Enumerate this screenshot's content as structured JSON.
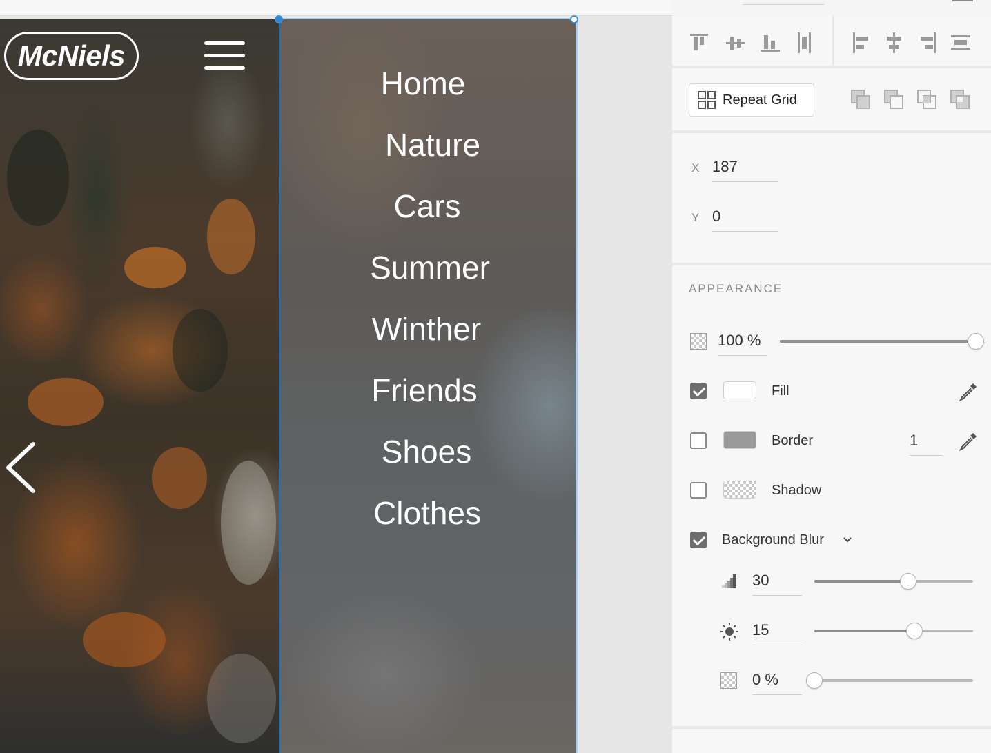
{
  "artboard": {
    "logo_text": "McNiels",
    "menu_items": [
      "Home",
      "Nature",
      "Cars",
      "Summer",
      "Winther",
      "Friends",
      "Shoes",
      "Clothes"
    ]
  },
  "panel": {
    "repeat_grid_label": "Repeat Grid",
    "position": {
      "x_label": "X",
      "x_value": "187",
      "y_label": "Y",
      "y_value": "0"
    },
    "appearance": {
      "title": "APPEARANCE",
      "opacity_value": "100 %",
      "opacity_fraction": 1.0,
      "fill": {
        "label": "Fill",
        "checked": true,
        "color": "#ffffff"
      },
      "border": {
        "label": "Border",
        "checked": false,
        "color": "#9a9a9a",
        "width": "1"
      },
      "shadow": {
        "label": "Shadow",
        "checked": false
      },
      "background_blur": {
        "label": "Background Blur",
        "checked": true,
        "amount": "30",
        "amount_fraction": 0.59,
        "brightness": "15",
        "brightness_fraction": 0.63,
        "effect_opacity": "0 %",
        "effect_opacity_fraction": 0.0
      }
    }
  },
  "icons": {
    "align": [
      "align-top-icon",
      "align-middle-icon",
      "align-bottom-icon",
      "distribute-vertical-icon",
      "align-left-icon",
      "align-center-icon",
      "align-right-icon",
      "distribute-horizontal-icon"
    ],
    "boolean": [
      "add-icon",
      "subtract-icon",
      "intersect-icon",
      "exclude-icon"
    ]
  },
  "colors": {
    "selection": "#2f86d6",
    "panel_bg": "#f7f7f7"
  }
}
